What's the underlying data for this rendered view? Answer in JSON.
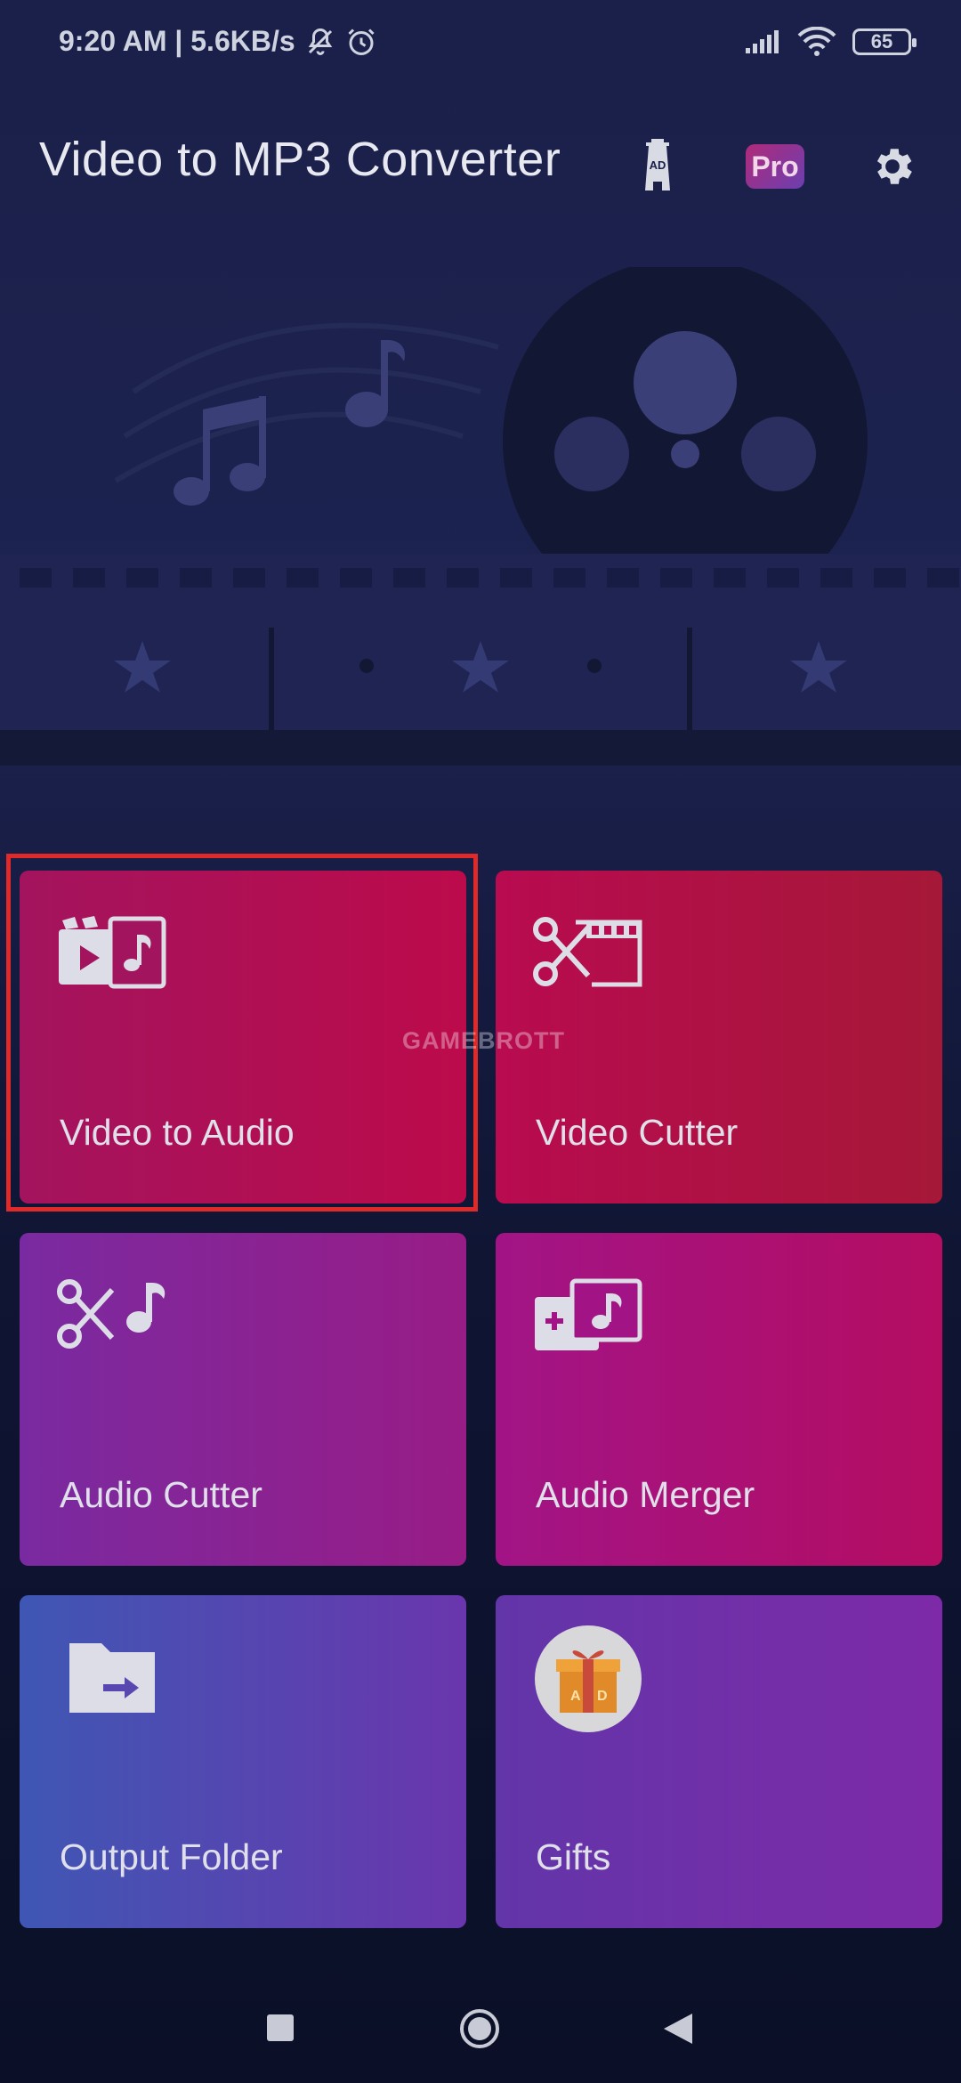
{
  "status_bar": {
    "time_speed": "9:20 AM | 5.6KB/s",
    "battery": "65"
  },
  "app_bar": {
    "title": "Video to MP3 Converter",
    "pro_label": "Pro",
    "ad_label": "AD"
  },
  "tiles": [
    {
      "label": "Video to Audio",
      "icon": "video-to-audio-icon"
    },
    {
      "label": "Video Cutter",
      "icon": "video-cutter-icon"
    },
    {
      "label": "Audio Cutter",
      "icon": "audio-cutter-icon"
    },
    {
      "label": "Audio Merger",
      "icon": "audio-merger-icon"
    },
    {
      "label": "Output Folder",
      "icon": "output-folder-icon"
    },
    {
      "label": "Gifts",
      "icon": "gift-icon"
    }
  ],
  "watermark": "GAMEBROTT",
  "colors": {
    "highlight": "#e02a2a",
    "background": "#0b1128"
  }
}
